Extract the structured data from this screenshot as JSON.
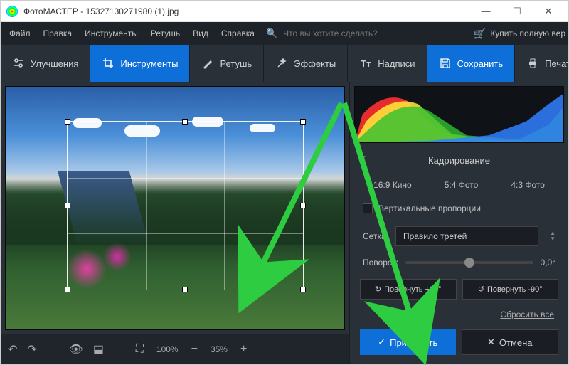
{
  "window": {
    "title": "ФотоМАСТЕР - 15327130271980 (1).jpg"
  },
  "menu": {
    "items": [
      "Файл",
      "Правка",
      "Инструменты",
      "Ретушь",
      "Вид",
      "Справка"
    ],
    "search_placeholder": "Что вы хотите сделать?",
    "buy": "Купить полную вер"
  },
  "toolbar": {
    "enhance": "Улучшения",
    "tools": "Инструменты",
    "retouch": "Ретушь",
    "effects": "Эффекты",
    "captions": "Надписи",
    "save": "Сохранить",
    "print": "Печать"
  },
  "bottom": {
    "fit_zoom": "100%",
    "current_zoom": "35%"
  },
  "panel": {
    "title": "Кадрирование",
    "ratios": [
      "16:9 Кино",
      "5:4 Фото",
      "4:3 Фото"
    ],
    "vertical_proportions": "Вертикальные пропорции",
    "grid_label": "Сетка:",
    "grid_value": "Правило третей",
    "rotate_label": "Поворот:",
    "rotate_value": "0,0°",
    "rotate_plus": "Повернуть +90°",
    "rotate_minus": "Повернуть -90°",
    "reset": "Сбросить все",
    "apply": "Применить",
    "cancel": "Отмена"
  }
}
